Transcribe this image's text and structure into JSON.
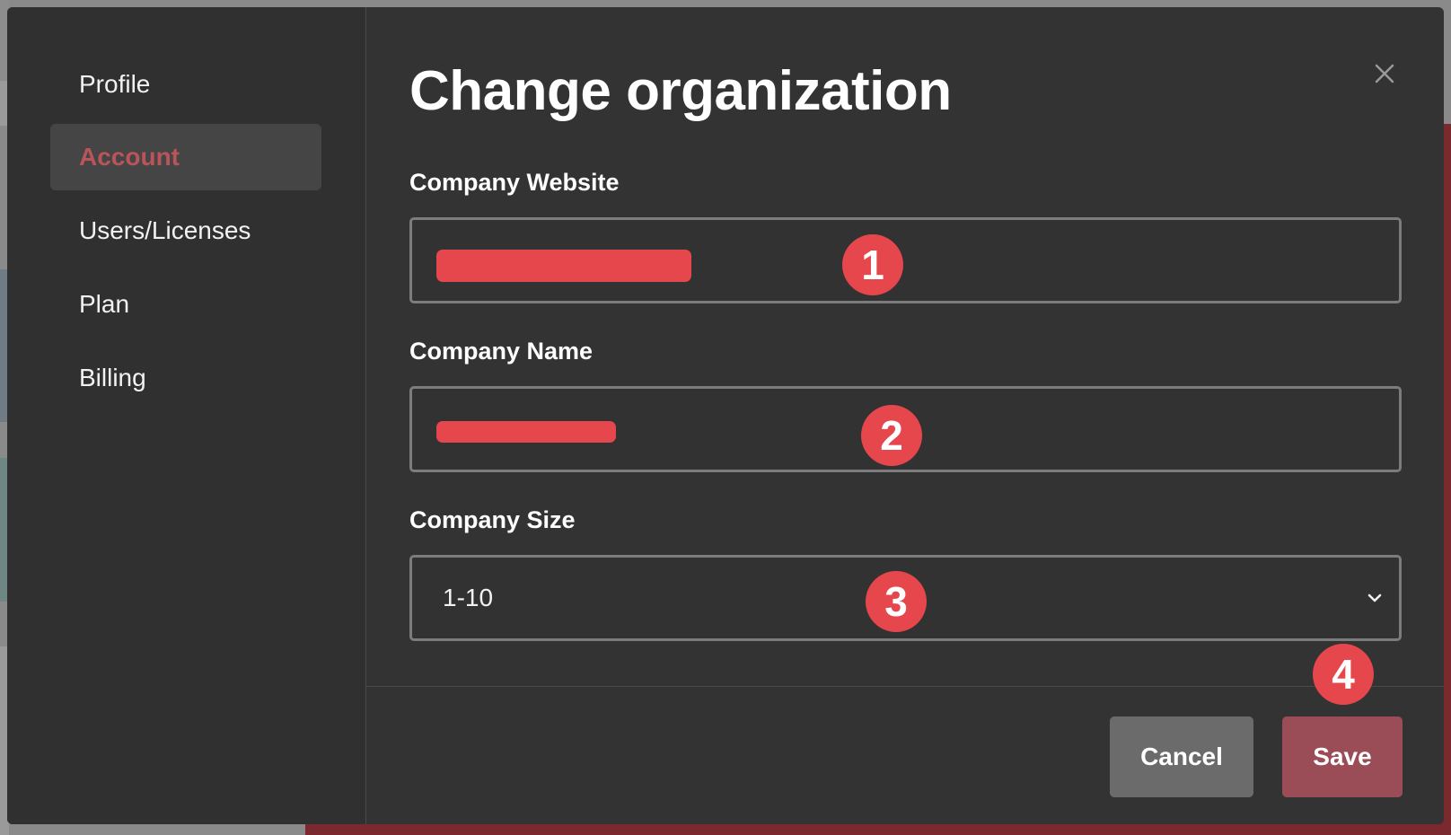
{
  "sidebar": {
    "items": [
      {
        "label": "Profile",
        "active": false
      },
      {
        "label": "Account",
        "active": true
      },
      {
        "label": "Users/Licenses",
        "active": false
      },
      {
        "label": "Plan",
        "active": false
      },
      {
        "label": "Billing",
        "active": false
      }
    ]
  },
  "dialog": {
    "title": "Change organization",
    "close_icon": "close-icon"
  },
  "form": {
    "website_label": "Company Website",
    "website_value": "",
    "name_label": "Company Name",
    "name_value": "",
    "size_label": "Company Size",
    "size_value": "1-10"
  },
  "annotations": [
    "1",
    "2",
    "3",
    "4"
  ],
  "footer": {
    "cancel_label": "Cancel",
    "save_label": "Save"
  },
  "colors": {
    "accent": "#e5474c",
    "active_nav_text": "#b9545b",
    "save_button": "#9a4d56",
    "cancel_button": "#6b6b6b",
    "modal_bg": "#333333"
  }
}
